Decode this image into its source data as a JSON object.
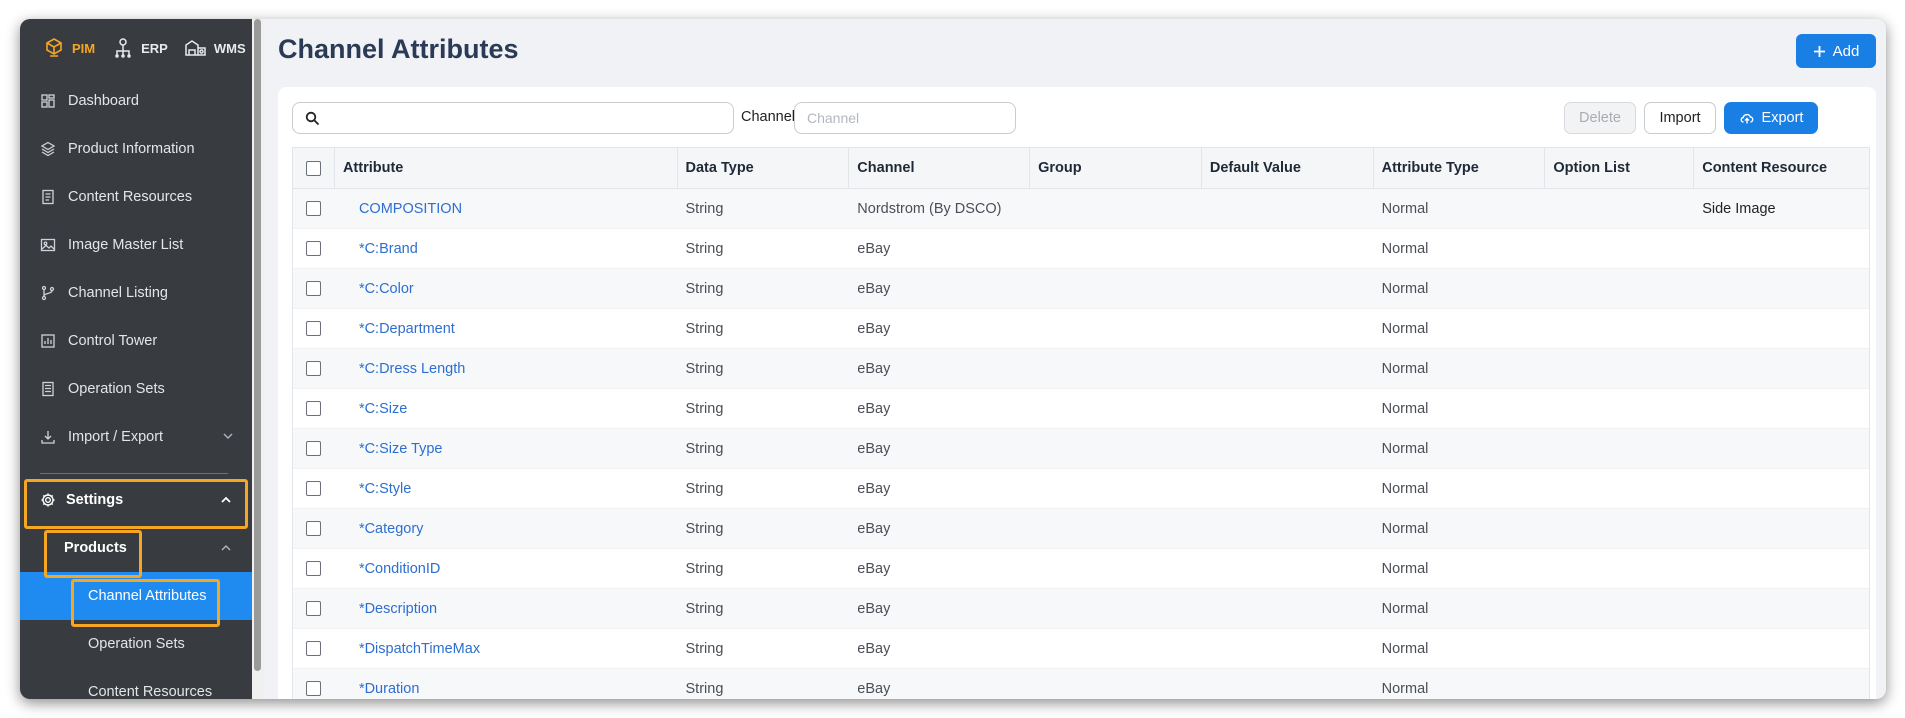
{
  "modules": [
    {
      "label": "PIM",
      "icon": "pim-cube-icon",
      "active": true
    },
    {
      "label": "ERP",
      "icon": "erp-network-icon",
      "active": false
    },
    {
      "label": "WMS",
      "icon": "wms-warehouse-icon",
      "active": false
    }
  ],
  "sidebar": {
    "items": [
      {
        "label": "Dashboard",
        "icon": "dashboard-icon"
      },
      {
        "label": "Product Information",
        "icon": "product-cube-icon"
      },
      {
        "label": "Content Resources",
        "icon": "document-icon"
      },
      {
        "label": "Image Master List",
        "icon": "image-icon"
      },
      {
        "label": "Channel Listing",
        "icon": "branch-icon"
      },
      {
        "label": "Control Tower",
        "icon": "chart-icon"
      },
      {
        "label": "Operation Sets",
        "icon": "list-icon"
      },
      {
        "label": "Import / Export",
        "icon": "download-icon"
      }
    ],
    "settings": {
      "label": "Settings"
    },
    "products": {
      "label": "Products"
    },
    "leaves": [
      {
        "label": "Channel Attributes",
        "active": true
      },
      {
        "label": "Operation Sets",
        "active": false
      },
      {
        "label": "Content Resources",
        "active": false
      }
    ]
  },
  "header": {
    "title": "Channel Attributes",
    "add_label": "Add"
  },
  "toolbar": {
    "channel_label": "Channel",
    "channel_placeholder": "Channel",
    "delete_label": "Delete",
    "import_label": "Import",
    "export_label": "Export"
  },
  "table": {
    "columns": [
      "Attribute",
      "Data Type",
      "Channel",
      "Group",
      "Default Value",
      "Attribute Type",
      "Option List",
      "Content Resource"
    ],
    "rows": [
      [
        "COMPOSITION",
        "String",
        "Nordstrom (By DSCO)",
        "",
        "",
        "Normal",
        "",
        "Side Image"
      ],
      [
        "*C:Brand",
        "String",
        "eBay",
        "",
        "",
        "Normal",
        "",
        ""
      ],
      [
        "*C:Color",
        "String",
        "eBay",
        "",
        "",
        "Normal",
        "",
        ""
      ],
      [
        "*C:Department",
        "String",
        "eBay",
        "",
        "",
        "Normal",
        "",
        ""
      ],
      [
        "*C:Dress Length",
        "String",
        "eBay",
        "",
        "",
        "Normal",
        "",
        ""
      ],
      [
        "*C:Size",
        "String",
        "eBay",
        "",
        "",
        "Normal",
        "",
        ""
      ],
      [
        "*C:Size Type",
        "String",
        "eBay",
        "",
        "",
        "Normal",
        "",
        ""
      ],
      [
        "*C:Style",
        "String",
        "eBay",
        "",
        "",
        "Normal",
        "",
        ""
      ],
      [
        "*Category",
        "String",
        "eBay",
        "",
        "",
        "Normal",
        "",
        ""
      ],
      [
        "*ConditionID",
        "String",
        "eBay",
        "",
        "",
        "Normal",
        "",
        ""
      ],
      [
        "*Description",
        "String",
        "eBay",
        "",
        "",
        "Normal",
        "",
        ""
      ],
      [
        "*DispatchTimeMax",
        "String",
        "eBay",
        "",
        "",
        "Normal",
        "",
        ""
      ],
      [
        "*Duration",
        "String",
        "eBay",
        "",
        "",
        "Normal",
        "",
        ""
      ]
    ]
  },
  "colors": {
    "accent": "#1a7fe5",
    "sidebar_bg": "#383c41",
    "highlight": "#f5a623",
    "link": "#2d6fd1"
  }
}
